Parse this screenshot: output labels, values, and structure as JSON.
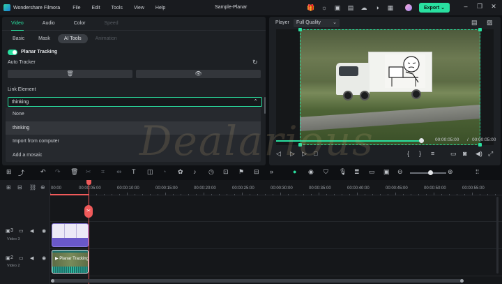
{
  "app": {
    "name": "Wondershare Filmora",
    "document_title": "Sample-Planar",
    "export_label": "Export",
    "menus": [
      "File",
      "Edit",
      "Tools",
      "View",
      "Help"
    ]
  },
  "colors": {
    "accent": "#29e0a0",
    "playhead": "#f05a5a",
    "clip_video3": "#6a58c9",
    "clip_video2": "#1f6f6a"
  },
  "left_panel": {
    "tabs": [
      "Video",
      "Audio",
      "Color",
      "Speed"
    ],
    "active_tab": "Video",
    "subtabs": [
      "Basic",
      "Mask",
      "AI Tools",
      "Animation"
    ],
    "active_subtab": "AI Tools",
    "planar_tracking": {
      "title": "Planar Tracking",
      "enabled": true,
      "auto_tracker_label": "Auto Tracker",
      "delete_icon": "trash-icon",
      "view_icon": "eye-icon",
      "refresh_icon": "refresh-icon"
    },
    "link_element": {
      "label": "Link Element",
      "selected_value": "thinking"
    },
    "dropdown_options": [
      "None",
      "thinking",
      "Import from computer",
      "Add a mosaic"
    ]
  },
  "player": {
    "label": "Player",
    "quality": "Full Quality",
    "current_time": "00:00:05:00",
    "total_time": "00:00:05:00",
    "separator": "/",
    "progress": 1.0
  },
  "timeline": {
    "ruler_labels": [
      "00:00",
      "00:00:05:00",
      "00:00:10:00",
      "00:00:15:00",
      "00:00:20:00",
      "00:00:25:00",
      "00:00:30:00",
      "00:00:35:00",
      "00:00:40:00",
      "00:00:45:00",
      "00:00:50:00",
      "00:00:55:00"
    ],
    "tracks": [
      {
        "name": "Video 3",
        "number": "3"
      },
      {
        "name": "Video 2",
        "number": "2"
      }
    ],
    "clip_video2_label": "Planar Tracking"
  },
  "watermark": "Dealarious"
}
